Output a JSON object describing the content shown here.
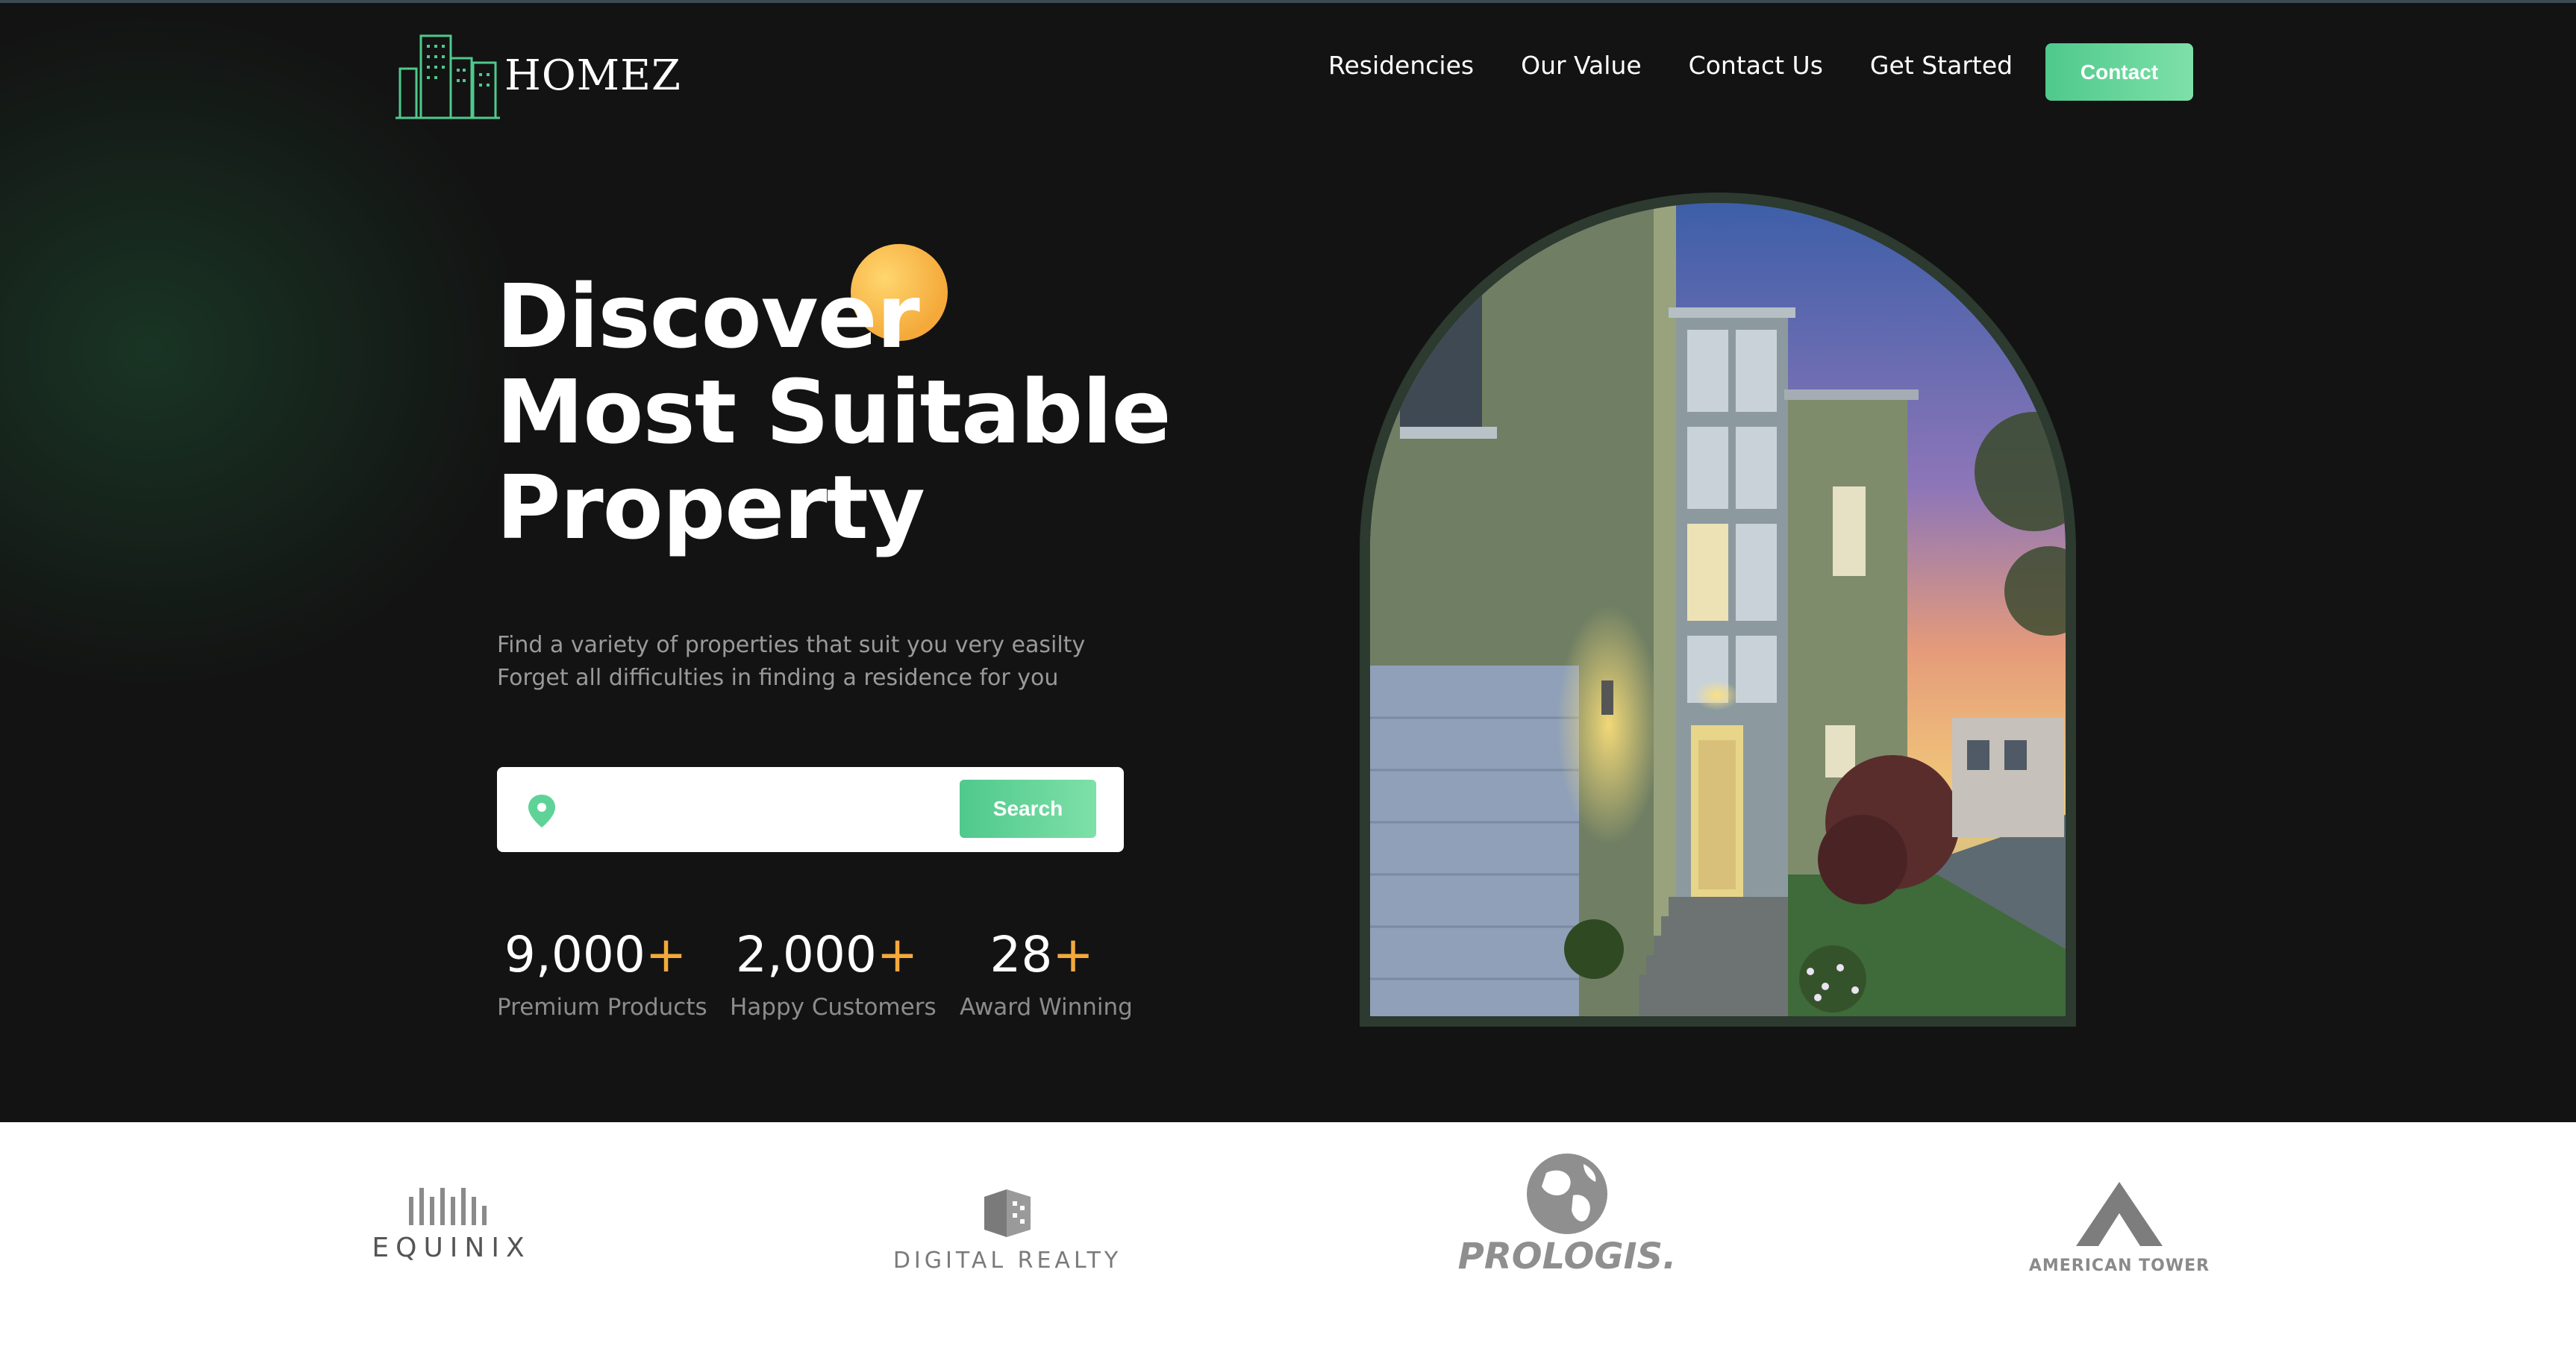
{
  "brand": {
    "logo_text": "HOMEZ",
    "logo_icon": "buildings-icon"
  },
  "nav": {
    "links": [
      "Residencies",
      "Our Value",
      "Contact Us",
      "Get Started"
    ],
    "contact_label": "Contact"
  },
  "hero": {
    "headline": [
      "Discover",
      "Most Suitable",
      "Property"
    ],
    "subtitle": [
      "Find a variety of properties that suit you very easilty",
      "Forget all difficulties in finding a residence for you"
    ],
    "search": {
      "icon": "location-pin-icon",
      "placeholder": "",
      "value": "",
      "button_label": "Search"
    },
    "stats": [
      {
        "number": "9,000",
        "suffix": "+",
        "label": "Premium Products"
      },
      {
        "number": "2,000",
        "suffix": "+",
        "label": "Happy Customers"
      },
      {
        "number": "28",
        "suffix": "+",
        "label": "Award Winning"
      }
    ]
  },
  "partners": [
    "EQUINIX",
    "DIGITAL REALTY",
    "PROLOGIS.",
    "AMERICAN TOWER"
  ],
  "colors": {
    "background": "#131313",
    "accent_green": "#5fd397",
    "accent_orange": "#f4a93a",
    "text_muted": "#8c8c8c"
  }
}
